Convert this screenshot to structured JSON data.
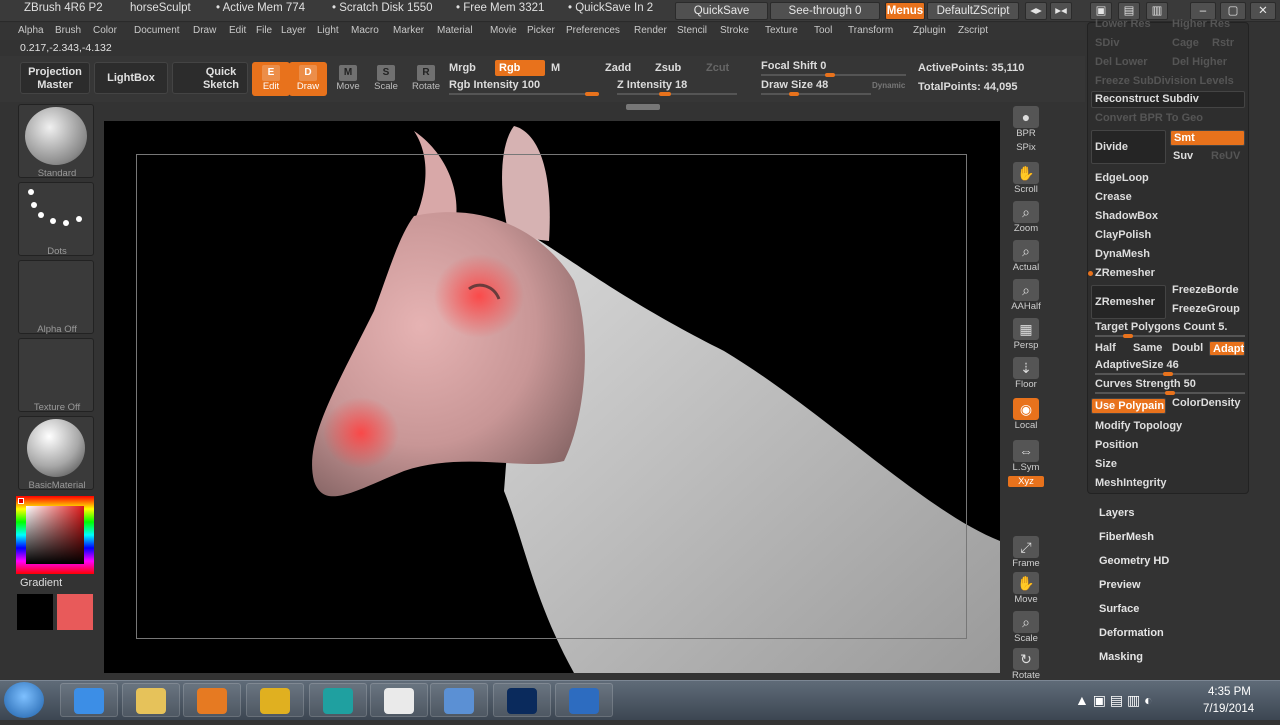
{
  "titlebar": {
    "app": "ZBrush 4R6 P2",
    "doc": "horseSculpt",
    "active_mem": "• Active Mem 774",
    "scratch": "• Scratch Disk 1550",
    "free_mem": "• Free Mem 3321",
    "quicksave_in": "• QuickSave In 2",
    "quicksave_btn": "QuickSave",
    "seethrough": "See-through 0",
    "menus_btn": "Menus",
    "script": "DefaultZScript"
  },
  "menu": [
    "Alpha",
    "Brush",
    "Color",
    "Document",
    "Draw",
    "Edit",
    "File",
    "Layer",
    "Light",
    "Macro",
    "Marker",
    "Material",
    "Movie",
    "Picker",
    "Preferences",
    "Render",
    "Stencil",
    "Stroke",
    "Texture",
    "Tool",
    "Transform",
    "Zplugin",
    "Zscript"
  ],
  "coords": "0.217,-2.343,-4.132",
  "toolbar": {
    "projection": "Projection\nMaster",
    "lightbox": "LightBox",
    "quicksketch": "Quick\nSketch",
    "tools": [
      {
        "label": "Edit",
        "on": true
      },
      {
        "label": "Draw",
        "on": true
      },
      {
        "label": "Move",
        "on": false
      },
      {
        "label": "Scale",
        "on": false
      },
      {
        "label": "Rotate",
        "on": false
      }
    ],
    "mrgb": "Mrgb",
    "rgb": "Rgb",
    "m": "M",
    "rgb_intensity": "Rgb Intensity 100",
    "zadd": "Zadd",
    "zsub": "Zsub",
    "zcut": "Zcut",
    "z_intensity": "Z Intensity 18",
    "focal_shift": "Focal Shift 0",
    "draw_size": "Draw Size 48",
    "dynamic": "Dynamic",
    "active_points": "ActivePoints: 35,110",
    "total_points": "TotalPoints: 44,095"
  },
  "left": {
    "brush": "Standard",
    "stroke": "Dots",
    "alpha": "Alpha  Off",
    "texture": "Texture  Off",
    "material": "BasicMaterial",
    "gradient": "Gradient",
    "main_color": "#000000",
    "secondary_color": "#e85a5a"
  },
  "nav": [
    "BPR",
    "SPix",
    "Scroll",
    "Zoom",
    "Actual",
    "AAHalf",
    "Persp",
    "Floor",
    "Local",
    "L.Sym",
    "Xyz",
    "Frame",
    "Move",
    "Scale",
    "Rotate"
  ],
  "geometry": {
    "top_dim": [
      "Lower Res",
      "Higher Res",
      "SDiv",
      "Cage",
      "Rstr",
      "Del Lower",
      "Del Higher",
      "Freeze SubDivision Levels"
    ],
    "reconstruct": "Reconstruct Subdiv",
    "convert_bpr": "Convert BPR To Geo",
    "divide": "Divide",
    "smt": "Smt",
    "suv": "Suv",
    "reuv": "ReUV",
    "items": [
      "EdgeLoop",
      "Crease",
      "ShadowBox",
      "ClayPolish",
      "DynaMesh"
    ],
    "zremesher_header": "ZRemesher",
    "zremesher_btn": "ZRemesher",
    "freeze_border": "FreezeBorde",
    "freeze_groups": "FreezeGroup",
    "target": "Target Polygons Count 5.",
    "half": "Half",
    "same": "Same",
    "double": "Doubl",
    "adapt": "Adapt",
    "adaptive": "AdaptiveSize 46",
    "curves": "Curves Strength 50",
    "use_polypaint": "Use Polypain",
    "color_density": "ColorDensity",
    "tail": [
      "Modify Topology",
      "Position",
      "Size",
      "MeshIntegrity"
    ]
  },
  "subpalettes": [
    "Layers",
    "FiberMesh",
    "Geometry HD",
    "Preview",
    "Surface",
    "Deformation",
    "Masking"
  ],
  "taskbar": {
    "time": "4:35 PM",
    "date": "7/19/2014",
    "apps": [
      "IE",
      "Explorer",
      "Media",
      "Chrome",
      "Maya",
      "ZBrush",
      "Viewer",
      "Ps",
      "App"
    ]
  }
}
